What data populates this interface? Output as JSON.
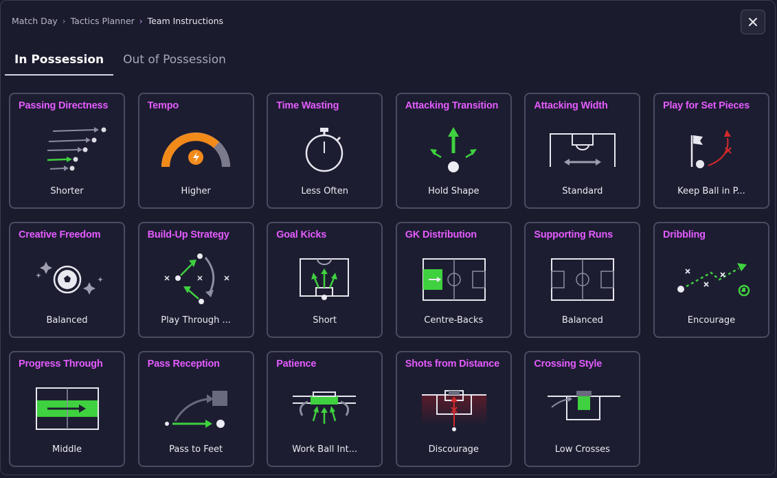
{
  "breadcrumb": [
    "Match Day",
    "Tactics Planner",
    "Team Instructions"
  ],
  "tabs": [
    {
      "label": "In Possession",
      "active": true
    },
    {
      "label": "Out of Possession",
      "active": false
    }
  ],
  "colors": {
    "title": "#e45cff",
    "accent_green": "#3fd13f",
    "accent_orange": "#f28a1a"
  },
  "cards": [
    {
      "title": "Passing Directness",
      "value": "Shorter",
      "icon": "passing-directness-icon"
    },
    {
      "title": "Tempo",
      "value": "Higher",
      "icon": "tempo-gauge-icon"
    },
    {
      "title": "Time Wasting",
      "value": "Less Often",
      "icon": "stopwatch-icon"
    },
    {
      "title": "Attacking Transition",
      "value": "Hold Shape",
      "icon": "attacking-transition-icon"
    },
    {
      "title": "Attacking Width",
      "value": "Standard",
      "icon": "attacking-width-icon"
    },
    {
      "title": "Play for Set Pieces",
      "value": "Keep Ball in P...",
      "icon": "corner-flag-icon"
    },
    {
      "title": "Creative Freedom",
      "value": "Balanced",
      "icon": "football-sparkle-icon"
    },
    {
      "title": "Build-Up Strategy",
      "value": "Play Through ...",
      "icon": "build-up-icon"
    },
    {
      "title": "Goal Kicks",
      "value": "Short",
      "icon": "goal-kicks-icon"
    },
    {
      "title": "GK Distribution",
      "value": "Centre-Backs",
      "icon": "gk-distribution-icon"
    },
    {
      "title": "Supporting Runs",
      "value": "Balanced",
      "icon": "supporting-runs-icon"
    },
    {
      "title": "Dribbling",
      "value": "Encourage",
      "icon": "dribbling-icon"
    },
    {
      "title": "Progress Through",
      "value": "Middle",
      "icon": "progress-through-icon"
    },
    {
      "title": "Pass Reception",
      "value": "Pass to Feet",
      "icon": "pass-reception-icon"
    },
    {
      "title": "Patience",
      "value": "Work Ball Int...",
      "icon": "patience-icon"
    },
    {
      "title": "Shots from Distance",
      "value": "Discourage",
      "icon": "shots-from-distance-icon"
    },
    {
      "title": "Crossing Style",
      "value": "Low Crosses",
      "icon": "crossing-style-icon"
    }
  ]
}
